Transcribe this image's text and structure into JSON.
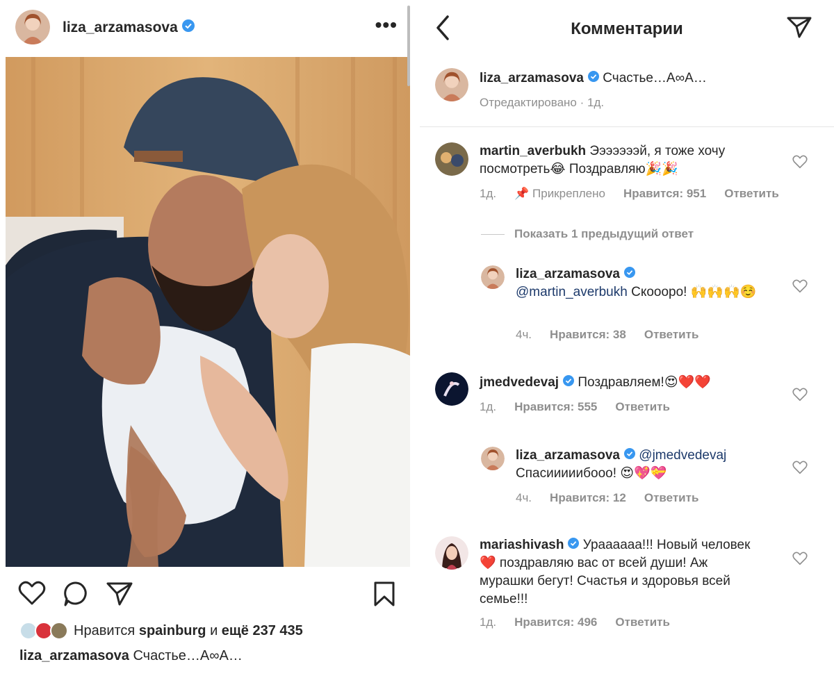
{
  "post": {
    "username": "liza_arzamasova",
    "more": "•••",
    "likes_prefix": "Нравится",
    "likes_user": "spainburg",
    "likes_mid": "и",
    "likes_count": "ещё 237 435",
    "caption_user": "liza_arzamasova",
    "caption_text": "Счастье…А∞А…"
  },
  "comments_panel": {
    "title": "Комментарии",
    "op": {
      "username": "liza_arzamasova",
      "text": "Счастье…А∞А…",
      "meta": "Отредактировано · 1д."
    },
    "comments": [
      {
        "username": "martin_averbukh",
        "text": "Эээээээй, я тоже хочу посмотреть😂 Поздравляю🎉🎉",
        "time": "1д.",
        "pinned": "Прикреплено",
        "likes": "Нравится: 951",
        "reply": "Ответить"
      },
      {
        "show_replies": "Показать 1 предыдущий ответ"
      },
      {
        "username": "liza_arzamasova",
        "mention": "@martin_averbukh",
        "text": "Скооорo! 🙌🙌🙌☺️",
        "time": "4ч.",
        "likes": "Нравится: 38",
        "reply": "Ответить"
      },
      {
        "username": "jmedvedevaj",
        "text": "Поздравляем!😍❤️❤️",
        "time": "1д.",
        "likes": "Нравится: 555",
        "reply": "Ответить"
      },
      {
        "username": "liza_arzamasova",
        "mention": "@jmedvedevaj",
        "text": "Спасииииибооо! 😍💖💝",
        "time": "4ч.",
        "likes": "Нравится: 12",
        "reply": "Ответить"
      },
      {
        "username": "mariashivash",
        "text": "Ураааааа!!! Новый человек❤️ поздравляю вас от всей души! Аж мурашки бегут! Счастья и здоровья всей семье!!!",
        "time": "1д.",
        "likes": "Нравится: 496",
        "reply": "Ответить"
      }
    ]
  },
  "colors": {
    "verified": "#3897f0",
    "text": "#262626",
    "muted": "#8e8e8e",
    "heart_red": "#ed1c24"
  }
}
